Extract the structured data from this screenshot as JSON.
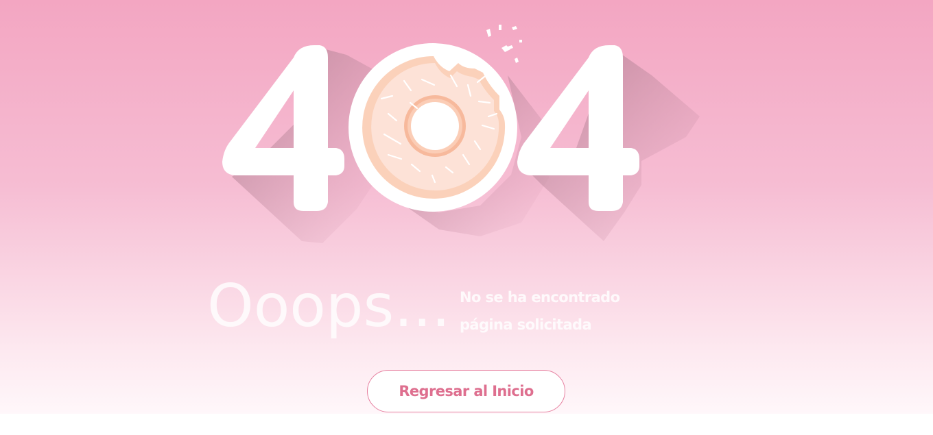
{
  "error_page": {
    "code_left": "4",
    "code_middle": "0",
    "code_right": "4",
    "middle_icon": "donut-icon",
    "headline": "Ooops...",
    "message": "No se ha encontrado página solicitada",
    "home_button_label": "Regresar al Inicio"
  },
  "colors": {
    "background_top": "#f3a6c2",
    "background_bottom": "#fff7fa",
    "digit": "#ffffff",
    "donut_dough": "#fbd1ba",
    "donut_glaze": "#fde2d7",
    "button_text": "#de6f8f",
    "button_border": "#e67f9f"
  }
}
